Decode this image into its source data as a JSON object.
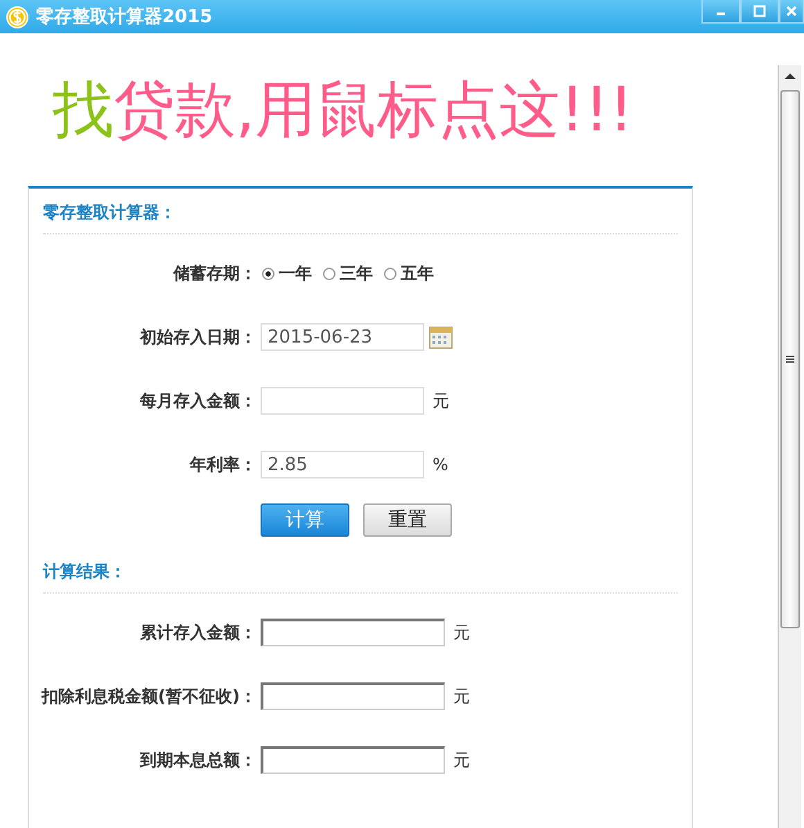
{
  "window": {
    "title": "零存整取计算器2015"
  },
  "banner": [
    {
      "text": "找",
      "color": "#8cc21a"
    },
    {
      "text": "贷款,用鼠标点这!!!",
      "color": "#ff5c8a"
    }
  ],
  "input_section": {
    "heading": "零存整取计算器：",
    "term": {
      "label": "储蓄存期：",
      "options": [
        {
          "label": "一年",
          "selected": true
        },
        {
          "label": "三年",
          "selected": false
        },
        {
          "label": "五年",
          "selected": false
        }
      ]
    },
    "fields": [
      {
        "kind": "date",
        "label": "初始存入日期：",
        "value": "2015-06-23"
      },
      {
        "kind": "unit",
        "label": "每月存入金额：",
        "unit": "元"
      },
      {
        "kind": "unit",
        "label": "年利率：",
        "value": "2.85",
        "unit": "%"
      }
    ],
    "buttons": [
      {
        "label": "计算",
        "kind": "primary"
      },
      {
        "label": "重置",
        "kind": "secondary"
      }
    ]
  },
  "result_section": {
    "heading": "计算结果：",
    "fields": [
      {
        "label": "累计存入金额：",
        "unit": "元"
      },
      {
        "label": "扣除利息税金额(暂不征收)：",
        "unit": "元"
      },
      {
        "label": "到期本息总额：",
        "unit": "元"
      }
    ]
  }
}
